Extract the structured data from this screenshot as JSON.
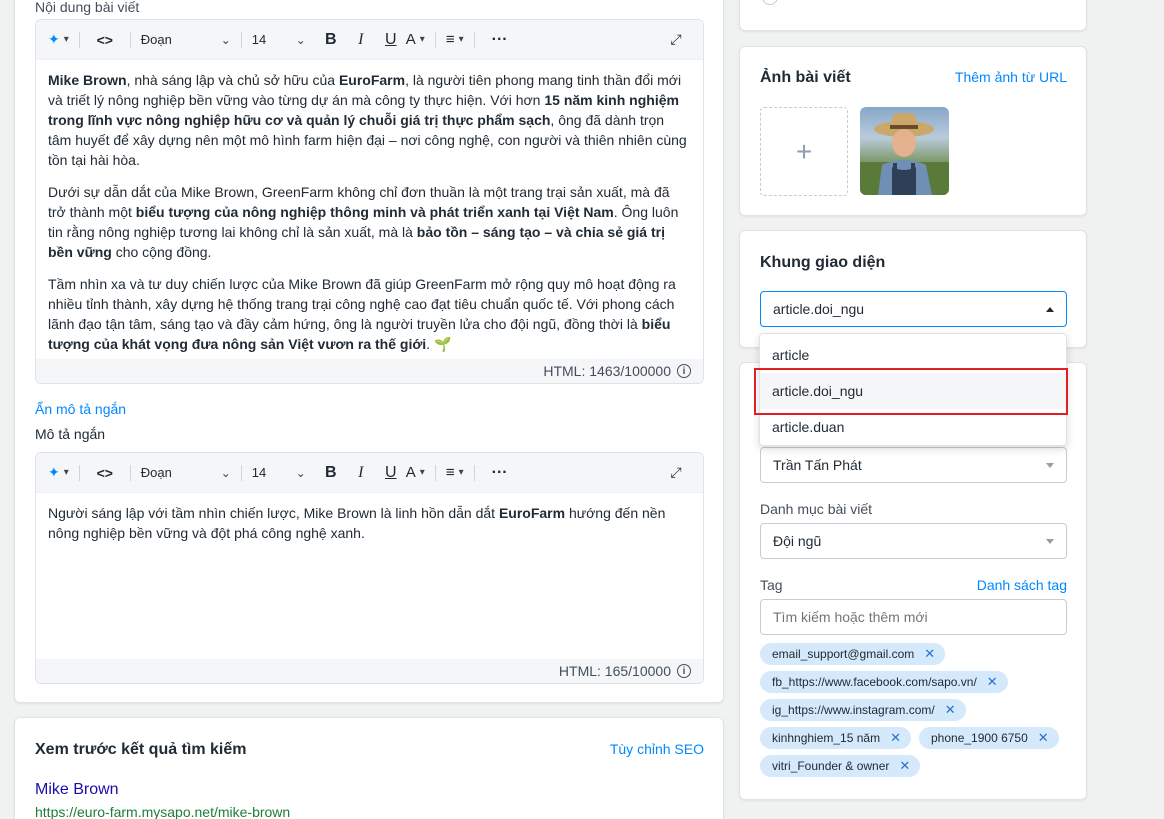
{
  "content_section": {
    "label": "Nội dung bài viết",
    "toolbar": {
      "paragraph": "Đoạn",
      "font_size": "14"
    },
    "body": {
      "p1": [
        {
          "t": "Mike Brown",
          "b": true
        },
        {
          "t": ", nhà sáng lập và chủ sở hữu của ",
          "b": false
        },
        {
          "t": "EuroFarm",
          "b": true
        },
        {
          "t": ", là người tiên phong mang tinh thần đổi mới và triết lý nông nghiệp bền vững vào từng dự án mà công ty thực hiện. Với hơn ",
          "b": false
        },
        {
          "t": "15 năm kinh nghiệm trong lĩnh vực nông nghiệp hữu cơ và quản lý chuỗi giá trị thực phẩm sạch",
          "b": true
        },
        {
          "t": ", ông đã dành trọn tâm huyết để xây dựng nên một mô hình farm hiện đại – nơi công nghệ, con người và thiên nhiên cùng tồn tại hài hòa.",
          "b": false
        }
      ],
      "p2": [
        {
          "t": "Dưới sự dẫn dắt của Mike Brown, GreenFarm không chỉ đơn thuần là một trang trại sản xuất, mà đã trở thành một ",
          "b": false
        },
        {
          "t": "biểu tượng của nông nghiệp thông minh và phát triển xanh tại Việt Nam",
          "b": true
        },
        {
          "t": ". Ông luôn tin rằng nông nghiệp tương lai không chỉ là sản xuất, mà là ",
          "b": false
        },
        {
          "t": "bảo tồn – sáng tạo – và chia sẻ giá trị bền vững",
          "b": true
        },
        {
          "t": " cho cộng đồng.",
          "b": false
        }
      ],
      "p3": [
        {
          "t": "Tầm nhìn xa và tư duy chiến lược của Mike Brown đã giúp GreenFarm mở rộng quy mô hoạt động ra nhiều tỉnh thành, xây dựng hệ thống trang trại công nghệ cao đạt tiêu chuẩn quốc tế. Với phong cách lãnh đạo tận tâm, sáng tạo và đầy cảm hứng, ông là người truyền lửa cho đội ngũ, đồng thời là ",
          "b": false
        },
        {
          "t": "biểu tượng của khát vọng đưa nông sản Việt vươn ra thế giới",
          "b": true
        },
        {
          "t": ". 🌱",
          "b": false
        }
      ]
    },
    "html_count": "HTML: 1463/100000",
    "hide_short_desc": "Ẩn mô tả ngắn",
    "short_desc_label": "Mô tả ngắn",
    "short_desc": [
      {
        "t": "Người sáng lập với tầm nhìn chiến lược, Mike Brown là linh hồn dẫn dắt ",
        "b": false
      },
      {
        "t": "EuroFarm",
        "b": true
      },
      {
        "t": " hướng đến nền nông nghiệp bền vững và đột phá công nghệ xanh.",
        "b": false
      }
    ],
    "short_html_count": "HTML: 165/10000"
  },
  "seo": {
    "title": "Xem trước kết quả tìm kiếm",
    "customize": "Tùy chỉnh SEO",
    "preview_title": "Mike Brown",
    "preview_url": "https://euro-farm.mysapo.net/mike-brown"
  },
  "image_card": {
    "title": "Ảnh bài viết",
    "add_url": "Thêm ảnh từ URL",
    "plus": "+"
  },
  "template_card": {
    "title": "Khung giao diện",
    "selected": "article.doi_ngu",
    "options": [
      "article",
      "article.doi_ngu",
      "article.duan"
    ]
  },
  "meta_card": {
    "author": "Trần Tấn Phát",
    "category_label": "Danh mục bài viết",
    "category": "Đội ngũ",
    "tag_label": "Tag",
    "tag_list": "Danh sách tag",
    "tag_placeholder": "Tìm kiếm hoặc thêm mới",
    "tags": [
      "email_support@gmail.com",
      "fb_https://www.facebook.com/sapo.vn/",
      "ig_https://www.instagram.com/",
      "kinhnghiem_15 năm",
      "phone_1900 6750",
      "vitri_Founder & owner"
    ]
  },
  "colors": {
    "link": "#0088ff",
    "highlight": "#e02020",
    "tag_bg": "#d4e9fb"
  }
}
